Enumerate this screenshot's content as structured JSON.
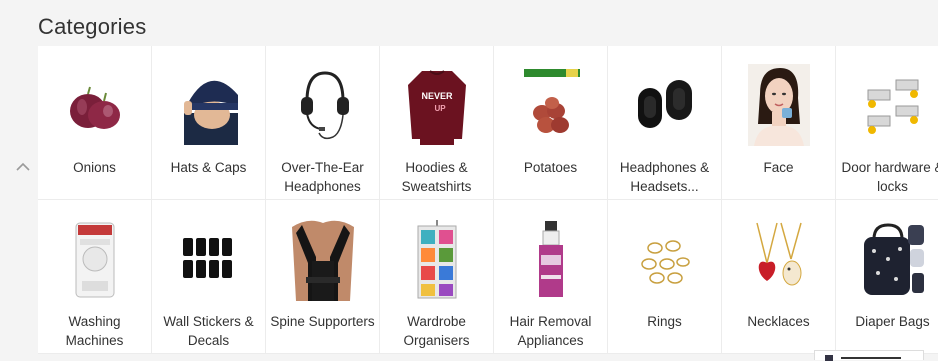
{
  "section": {
    "title": "Categories"
  },
  "nav": {
    "prev_icon": "chevron-up-icon"
  },
  "categories": [
    {
      "label": "Onions",
      "icon": "onion-icon"
    },
    {
      "label": "Hats & Caps",
      "icon": "hat-icon"
    },
    {
      "label": "Over-The-Ear Headphones",
      "icon": "headset-icon"
    },
    {
      "label": "Hoodies & Sweatshirts",
      "icon": "sweatshirt-icon"
    },
    {
      "label": "Potatoes",
      "icon": "potato-icon"
    },
    {
      "label": "Headphones & Headsets...",
      "icon": "ear-pads-icon"
    },
    {
      "label": "Face",
      "icon": "face-icon"
    },
    {
      "label": "Door hardware & locks",
      "icon": "door-hardware-icon"
    },
    {
      "label": "Washing Machines",
      "icon": "washing-machine-icon"
    },
    {
      "label": "Wall Stickers & Decals",
      "icon": "wall-stickers-icon"
    },
    {
      "label": "Spine Supporters",
      "icon": "posture-brace-icon"
    },
    {
      "label": "Wardrobe Organisers",
      "icon": "wardrobe-organiser-icon"
    },
    {
      "label": "Hair Removal Appliances",
      "icon": "hair-removal-cream-icon"
    },
    {
      "label": "Rings",
      "icon": "rings-icon"
    },
    {
      "label": "Necklaces",
      "icon": "necklaces-icon"
    },
    {
      "label": "Diaper Bags",
      "icon": "diaper-bag-icon"
    }
  ],
  "colors": {
    "background": "#f4f4f4",
    "card": "#ffffff",
    "text": "#333333",
    "divider": "#ececec"
  }
}
